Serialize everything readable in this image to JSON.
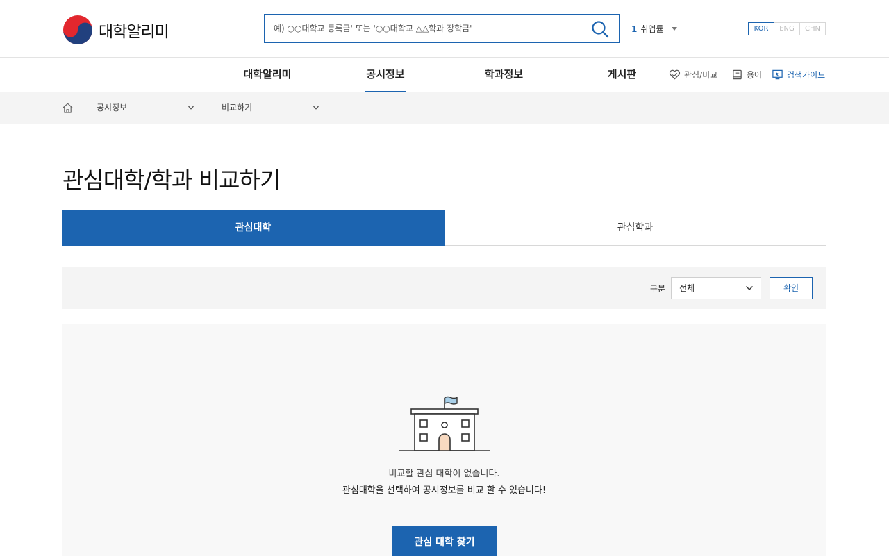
{
  "header": {
    "logo_text": "대학알리미",
    "search": {
      "placeholder": "예) ○○대학교 등록금' 또는 '○○대학교 △△학과 장학금'"
    },
    "ranking": {
      "number": "1",
      "label": "취업률"
    },
    "languages": [
      "KOR",
      "ENG",
      "CHN"
    ],
    "active_language": "KOR"
  },
  "nav": {
    "items": [
      "대학알리미",
      "공시정보",
      "학과정보",
      "게시판"
    ],
    "active": "공시정보",
    "utilities": [
      "관심/비교",
      "용어",
      "검색가이드"
    ]
  },
  "breadcrumb": {
    "items": [
      "공시정보",
      "비교하기"
    ]
  },
  "main": {
    "title": "관심대학/학과 비교하기",
    "tabs": [
      "관심대학",
      "관심학과"
    ],
    "active_tab": "관심대학",
    "filter": {
      "label": "구분",
      "selected": "전체",
      "confirm_label": "확인"
    },
    "empty_state": {
      "line1": "비교할 관심 대학이 없습니다.",
      "line2": "관심대학을 선택하여 공시정보를 비교 할 수 있습니다!",
      "button_label": "관심 대학 찾기"
    }
  },
  "colors": {
    "accent": "#1c64b0",
    "logo_red": "#e2272e",
    "logo_blue": "#21407e",
    "flag": "#a8cfe8",
    "door": "#f7d9c0"
  }
}
